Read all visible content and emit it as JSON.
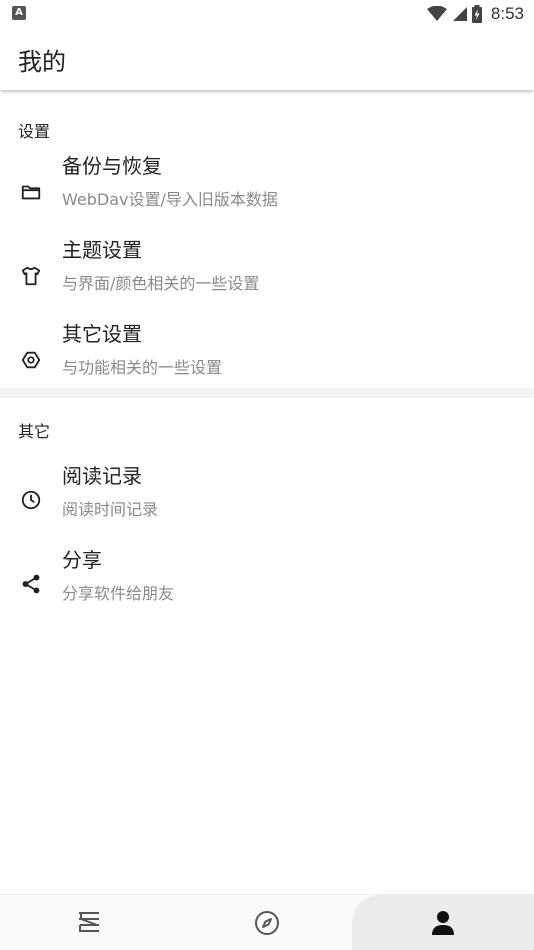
{
  "status_bar": {
    "left_badge": "A",
    "time": "8:53",
    "icons": [
      "wifi-icon",
      "signal-icon",
      "battery-charging-icon"
    ]
  },
  "header": {
    "title": "我的"
  },
  "sections": [
    {
      "title": "设置",
      "items": [
        {
          "icon": "folder-icon",
          "title": "备份与恢复",
          "subtitle": "WebDav设置/导入旧版本数据"
        },
        {
          "icon": "shirt-icon",
          "title": "主题设置",
          "subtitle": "与界面/颜色相关的一些设置"
        },
        {
          "icon": "settings-hex-icon",
          "title": "其它设置",
          "subtitle": "与功能相关的一些设置"
        }
      ]
    },
    {
      "title": "其它",
      "items": [
        {
          "icon": "clock-icon",
          "title": "阅读记录",
          "subtitle": "阅读时间记录"
        },
        {
          "icon": "share-icon",
          "title": "分享",
          "subtitle": "分享软件给朋友"
        }
      ]
    }
  ],
  "bottom_nav": {
    "tabs": [
      {
        "icon": "bookshelf-icon",
        "active": false
      },
      {
        "icon": "compass-icon",
        "active": false
      },
      {
        "icon": "person-icon",
        "active": true
      }
    ]
  },
  "colors": {
    "text_primary": "#222222",
    "text_secondary": "#8a8a8a",
    "divider": "#f3f3f3",
    "active_tab_bg": "#ebebeb"
  }
}
